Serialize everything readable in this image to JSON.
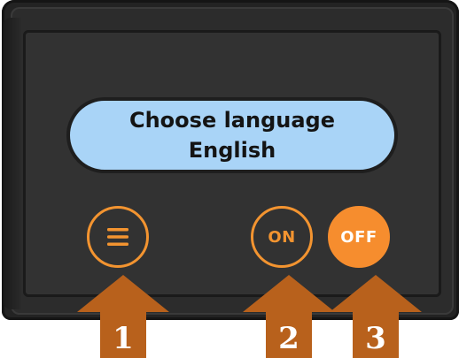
{
  "display": {
    "line1": "Choose language",
    "line2": "English"
  },
  "buttons": {
    "menu": {
      "icon": "menu-icon"
    },
    "on": {
      "label": "ON"
    },
    "off": {
      "label": "OFF"
    }
  },
  "arrows": [
    {
      "label": "1"
    },
    {
      "label": "2"
    },
    {
      "label": "3"
    }
  ],
  "colors": {
    "accent": "#f39430",
    "arrow": "#b8611c",
    "display": "#a9d4f7",
    "housing": "#2c2c2c"
  }
}
